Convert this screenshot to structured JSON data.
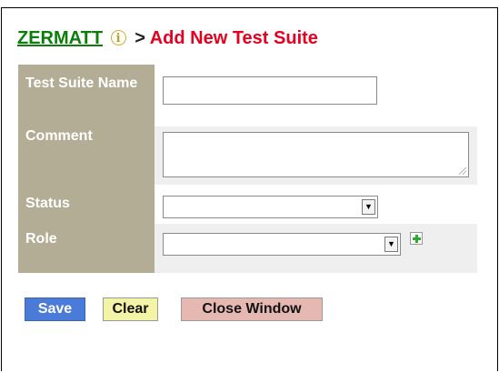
{
  "header": {
    "brand": "ZERMATT",
    "info_icon": "info-icon",
    "separator": ">",
    "current_page": "Add New Test Suite"
  },
  "form": {
    "name_label": "Test Suite Name",
    "name_value": "",
    "comment_label": "Comment",
    "comment_value": "",
    "status_label": "Status",
    "status_value": "",
    "role_label": "Role",
    "role_value": "",
    "add_role_icon": "add-plus-icon"
  },
  "buttons": {
    "save": "Save",
    "clear": "Clear",
    "close": "Close Window"
  },
  "colors": {
    "label_bg": "#b3ad95",
    "brand": "#0a7d0a",
    "title_red": "#e6001f",
    "save_bg": "#4b7bd8",
    "clear_bg": "#f4f4a6",
    "close_bg": "#e6b8b2"
  }
}
